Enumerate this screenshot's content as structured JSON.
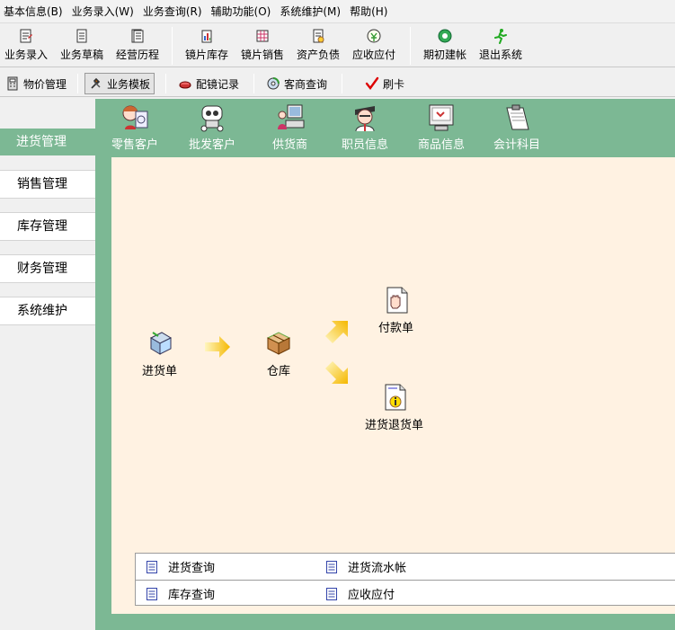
{
  "menu": [
    "基本信息(B)",
    "业务录入(W)",
    "业务查询(R)",
    "辅助功能(O)",
    "系统维护(M)",
    "帮助(H)"
  ],
  "toolbar": {
    "entry": "业务录入",
    "draft": "业务草稿",
    "history": "经营历程",
    "lens_stock": "镜片库存",
    "lens_sales": "镜片销售",
    "assets": "资产负债",
    "receivable": "应收应付",
    "opening": "期初建帐",
    "exit": "退出系统"
  },
  "toolbar2": {
    "price": "物价管理",
    "template": "业务模板",
    "glasses": "配镜记录",
    "customer_query": "客商查询",
    "card": "刷卡"
  },
  "nav": {
    "active": "进货管理",
    "items": [
      "销售管理",
      "库存管理",
      "财务管理",
      "系统维护"
    ]
  },
  "top_icons": {
    "retail": "零售客户",
    "wholesale": "批发客户",
    "supplier": "供货商",
    "staff": "职员信息",
    "goods": "商品信息",
    "accounts": "会计科目"
  },
  "flow": {
    "purchase": "进货单",
    "warehouse": "仓库",
    "payment": "付款单",
    "return": "进货退货单"
  },
  "links": {
    "purchase_query": "进货查询",
    "purchase_ledger": "进货流水帐",
    "stock_query": "库存查询",
    "receivable": "应收应付"
  },
  "colors": {
    "panel_green": "#7cb894",
    "workspace": "#fff2e2",
    "arrow": "#f5b800"
  }
}
